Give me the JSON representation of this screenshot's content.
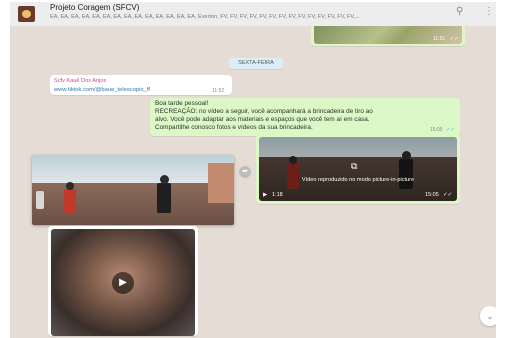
{
  "header": {
    "group_name": "Projeto Coragem (SFCV)",
    "members": "EA, EA, EA, EA, EA, EA, EA, EA, EA, EA, EA, EA, EA, EA, Everton, FV, FV, FV, FV, FV, FV, FV, FV, FV, FV, FV, FV, FV, FV,...",
    "icons": [
      "search-icon",
      "menu-dots-icon"
    ]
  },
  "chat": {
    "top_video_time": "11:51",
    "day_label": "SEXTA-FEIRA",
    "link_message": {
      "sender": "Scfv Kauê Dos Anjos",
      "url": "www.tiktok.com/@baue_telescopio_ff",
      "time": "11:52"
    },
    "text_message": {
      "lines": [
        "Boa tarde pessoal!",
        "RECREAÇÃO: no vídeo a seguir, você acompanhará a brincadeira de tiro ao",
        "alvo. Você pode adaptar aos materiais e espaços que você tem aí em casa.",
        "Compartilhe conosco fotos e vídeos da sua brincadeira."
      ],
      "time": "15:05"
    },
    "video_message": {
      "pip_notice": "Vídeo reproduzido no modo picture-in-picture",
      "duration": "1:18",
      "time": "15:05"
    }
  },
  "colors": {
    "chat_bg": "#e5ddd5",
    "outgoing_bubble": "#dcf8c6",
    "incoming_bubble": "#ffffff",
    "sender_name": "#d2468c",
    "link": "#2f78b3"
  }
}
